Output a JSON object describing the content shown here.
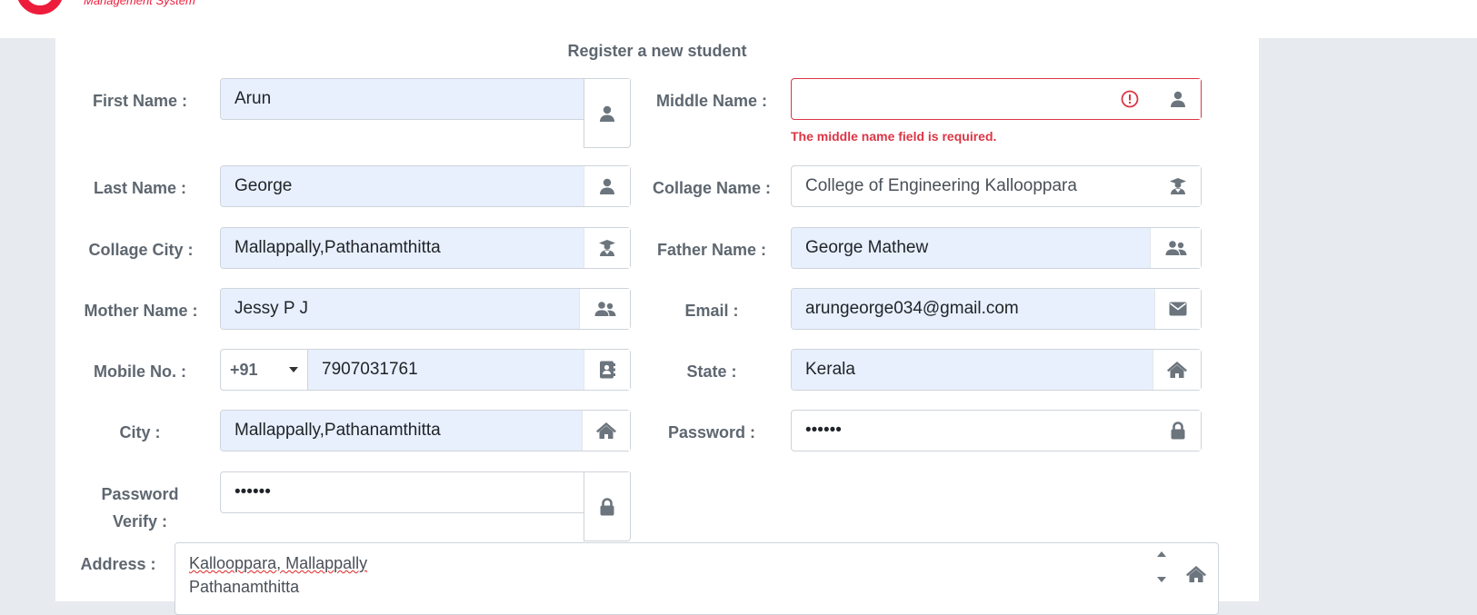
{
  "header": {
    "brand_text": "Management System"
  },
  "form": {
    "title": "Register a new student",
    "first_name": {
      "label": "First Name :",
      "value": "Arun"
    },
    "middle_name": {
      "label": "Middle Name :",
      "value": "",
      "error": "The middle name field is required."
    },
    "last_name": {
      "label": "Last Name :",
      "value": "George"
    },
    "collage_name": {
      "label": "Collage Name :",
      "value": "College of Engineering Kallooppara"
    },
    "collage_city": {
      "label": "Collage City :",
      "value": "Mallappally,Pathanamthitta"
    },
    "father_name": {
      "label": "Father Name :",
      "value": "George Mathew"
    },
    "mother_name": {
      "label": "Mother Name :",
      "value": "Jessy P J"
    },
    "email": {
      "label": "Email :",
      "value": "arungeorge034@gmail.com"
    },
    "mobile": {
      "label": "Mobile No. :",
      "code": "+91",
      "value": "7907031761"
    },
    "state": {
      "label": "State :",
      "value": "Kerala"
    },
    "city": {
      "label": "City :",
      "value": "Mallappally,Pathanamthitta"
    },
    "password": {
      "label": "Password :",
      "value": "••••••"
    },
    "password_verify": {
      "label_line1": "Password",
      "label_line2": "Verify :",
      "value": "••••••"
    },
    "address": {
      "label": "Address :",
      "line1": "Kallooppara, Mallappally",
      "line2": "Pathanamthitta"
    }
  },
  "icons": {
    "user": "user-icon",
    "graduate": "graduate-icon",
    "users": "users-icon",
    "envelope": "envelope-icon",
    "contact": "address-book-icon",
    "home": "home-icon",
    "lock": "lock-icon",
    "error": "error-circle-icon"
  },
  "colors": {
    "brand": "#ed1c3b",
    "error": "#dc3545",
    "autofill": "#e8f0fe",
    "label": "#5e6770"
  }
}
